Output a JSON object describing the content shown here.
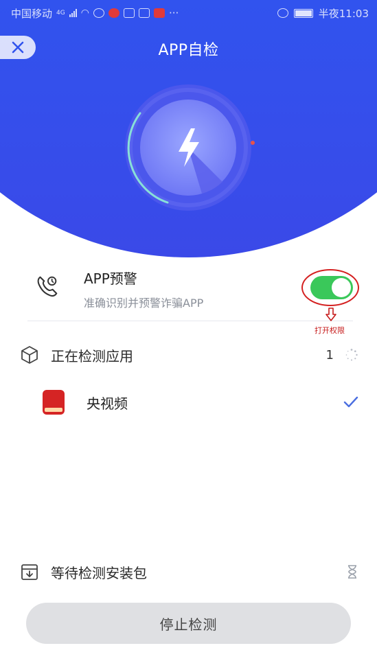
{
  "statusbar": {
    "carrier": "中国移动",
    "network": "4G",
    "time_label": "半夜11:03",
    "more": "···"
  },
  "header": {
    "title": "APP自检"
  },
  "feature": {
    "title": "APP预警",
    "subtitle": "准确识别并预警诈骗APP",
    "toggle_on": true,
    "annotation": "打开权限"
  },
  "scanning": {
    "label": "正在检测应用",
    "count": "1"
  },
  "apps": [
    {
      "name": "央视频",
      "status": "checked"
    }
  ],
  "waiting": {
    "label": "等待检测安装包"
  },
  "actions": {
    "stop_label": "停止检测"
  },
  "colors": {
    "header_blue": "#3153ee",
    "toggle_green": "#3ac85a",
    "annotation_red": "#d42020",
    "check_blue": "#4a6ee0"
  }
}
